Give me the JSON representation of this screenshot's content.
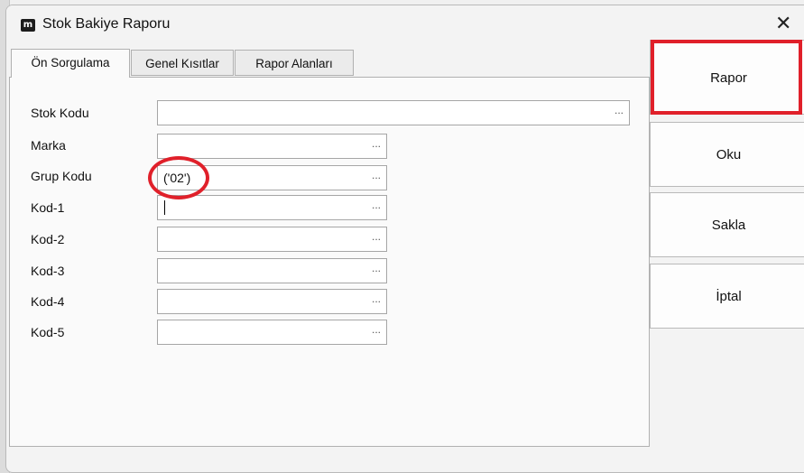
{
  "window": {
    "title": "Stok Bakiye Raporu",
    "icon_text": "m",
    "close_glyph": "✕"
  },
  "tabs": [
    {
      "label": "Ön Sorgulama",
      "active": true
    },
    {
      "label": "Genel Kısıtlar",
      "active": false
    },
    {
      "label": "Rapor Alanları",
      "active": false
    }
  ],
  "form": {
    "fields": [
      {
        "label": "Stok Kodu",
        "value": ""
      },
      {
        "label": "Marka",
        "value": ""
      },
      {
        "label": "Grup Kodu",
        "value": "('02')"
      },
      {
        "label": "Kod-1",
        "value": ""
      },
      {
        "label": "Kod-2",
        "value": ""
      },
      {
        "label": "Kod-3",
        "value": ""
      },
      {
        "label": "Kod-4",
        "value": ""
      },
      {
        "label": "Kod-5",
        "value": ""
      }
    ],
    "browse_glyph": "..."
  },
  "buttons": {
    "rapor": "Rapor",
    "oku": "Oku",
    "sakla": "Sakla",
    "iptal": "İptal"
  },
  "annotation_color": "#e0202a"
}
